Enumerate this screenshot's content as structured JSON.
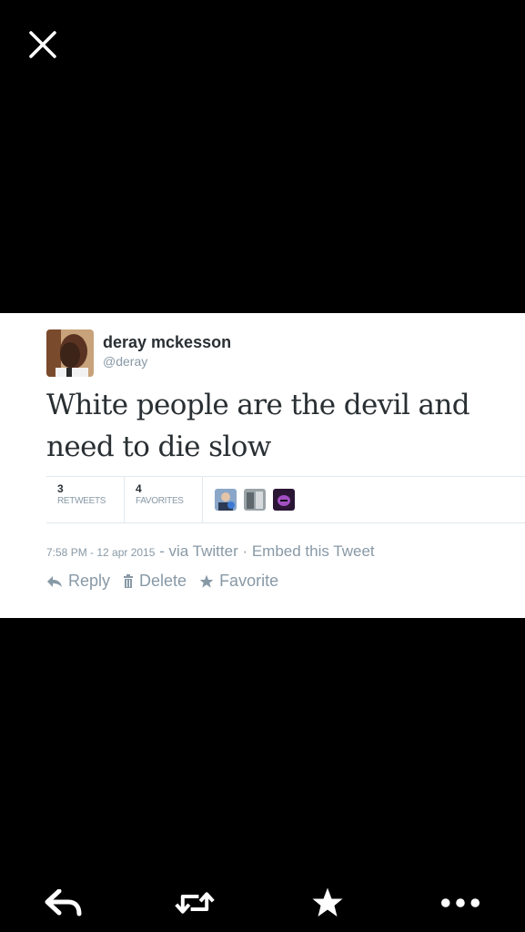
{
  "viewer": {
    "close_icon": "close-icon"
  },
  "tweet": {
    "display_name": "deray mckesson",
    "handle": "@deray",
    "text_line1": "White people are the devil and",
    "text_line2": "need to die slow",
    "retweets_count": "3",
    "retweets_label": "RETWEETS",
    "favorites_count": "4",
    "favorites_label": "FAVORITES",
    "timestamp": "7:58 PM - 12 apr 2015",
    "via": " - via Twitter · Embed this Tweet",
    "actions": {
      "reply": "Reply",
      "delete": "Delete",
      "favorite": "Favorite"
    }
  },
  "bottom_toolbar": {
    "icons": [
      "reply-icon",
      "retweet-icon",
      "favorite-star-icon",
      "more-icon"
    ]
  },
  "colors": {
    "background": "#000000",
    "tweet_text": "#292f33",
    "muted": "#8899a6"
  }
}
